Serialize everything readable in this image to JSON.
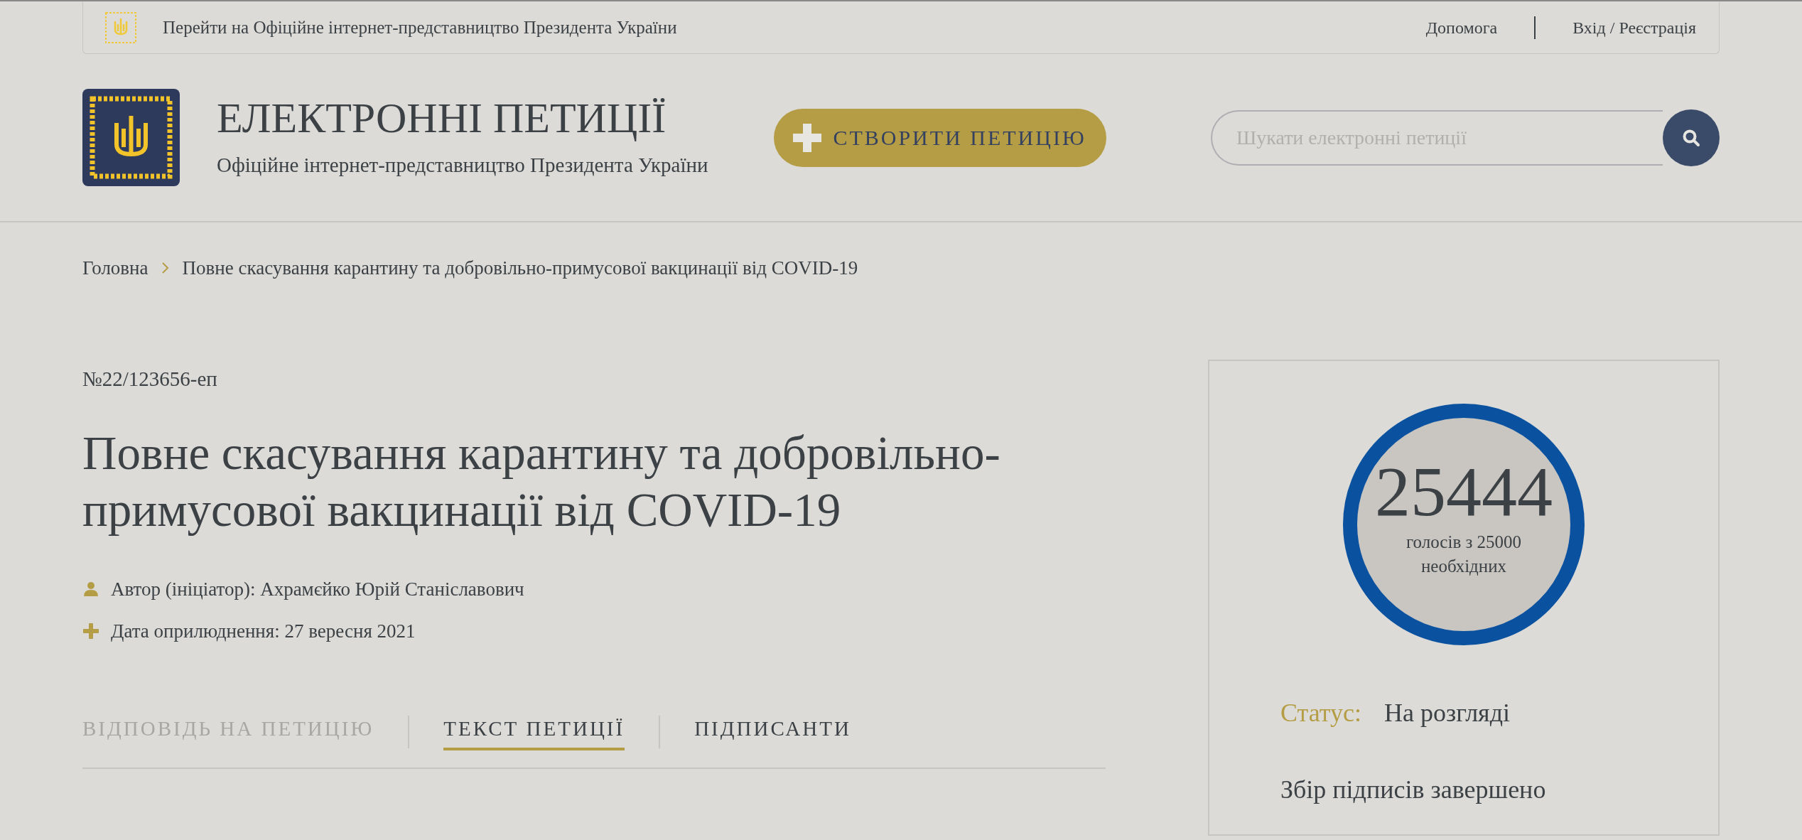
{
  "top_bar": {
    "link": "Перейти на Офіційне інтернет-представництво Президента України",
    "help": "Допомога",
    "login": "Вхід / Реєстрація"
  },
  "header": {
    "title": "ЕЛЕКТРОННІ ПЕТИЦІЇ",
    "subtitle": "Офіційне інтернет-представництво Президента України",
    "create_button": "СТВОРИТИ ПЕТИЦІЮ",
    "search": {
      "placeholder": "Шукати електронні петиції"
    }
  },
  "breadcrumb": [
    "Головна",
    "Повне скасування карантину та добровільно-примусової вакцинації від COVID-19"
  ],
  "petition": {
    "number": "№22/123656-еп",
    "title": "Повне скасування карантину та добровільно-примусової вакцинації від COVID-19",
    "meta": [
      {
        "kind": "author",
        "text": "Автор (ініціатор): Ахрамєйко Юрій Станіславович"
      },
      {
        "kind": "date",
        "text": "Дата оприлюднення: 27 вересня 2021"
      }
    ]
  },
  "tabs": [
    {
      "label": "ВІДПОВІДЬ НА ПЕТИЦІЮ",
      "selected": false,
      "disabled": true
    },
    {
      "label": "ТЕКСТ ПЕТИЦІЇ",
      "selected": true,
      "disabled": false
    },
    {
      "label": "ПІДПИСАНТИ",
      "selected": false,
      "disabled": false
    }
  ],
  "votes": {
    "count": "25444",
    "caption": "голосів з 25000 необхідних",
    "level": 1,
    "status_label": "Статус:",
    "status_value": "На розгляді",
    "note": "Збір підписів завершено"
  }
}
